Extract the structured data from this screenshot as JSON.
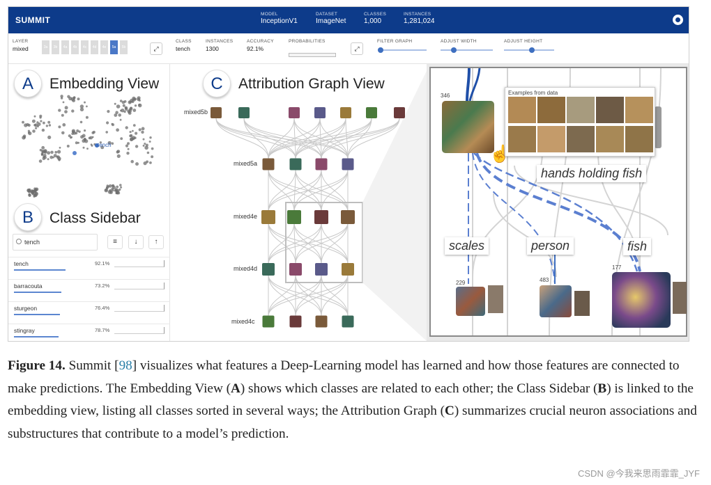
{
  "header": {
    "app_title": "SUMMIT",
    "fields": [
      {
        "key": "MODEL",
        "value": "InceptionV1"
      },
      {
        "key": "DATASET",
        "value": "ImageNet"
      },
      {
        "key": "CLASSES",
        "value": "1,000"
      },
      {
        "key": "INSTANCES",
        "value": "1,281,024"
      }
    ],
    "github_icon": "github-icon"
  },
  "controls": {
    "layer_key": "LAYER",
    "layer_value": "mixed",
    "layer_buttons": [
      "3a",
      "3b",
      "4a",
      "4b",
      "4c",
      "4d",
      "4e",
      "5a",
      "5b"
    ],
    "layer_selected": "5a",
    "class_key": "CLASS",
    "class_value": "tench",
    "instances_key": "INSTANCES",
    "instances_value": "1300",
    "accuracy_key": "ACCURACY",
    "accuracy_value": "92.1%",
    "probabilities_key": "PROBABILITIES",
    "filter_graph_key": "FILTER GRAPH",
    "adjust_width_key": "ADJUST WIDTH",
    "adjust_height_key": "ADJUST HEIGHT",
    "filter_graph_level": 0.05,
    "adjust_width_level": 0.25,
    "adjust_height_level": 0.55,
    "expand_icon": "expand-icon"
  },
  "embedding": {
    "badge": "A",
    "title": "Embedding View",
    "highlight_label": "tench"
  },
  "sidebar": {
    "badge": "B",
    "title": "Class Sidebar",
    "search_value": "tench",
    "sort_icons": [
      "sort-lines-icon",
      "arrow-down-icon",
      "arrow-up-icon"
    ],
    "classes": [
      {
        "name": "tench",
        "accuracy": "92.1%",
        "level": 0.92
      },
      {
        "name": "barracouta",
        "accuracy": "73.2%",
        "level": 0.73
      },
      {
        "name": "sturgeon",
        "accuracy": "76.4%",
        "level": 0.76
      },
      {
        "name": "stingray",
        "accuracy": "78.7%",
        "level": 0.79
      }
    ]
  },
  "graph": {
    "badge": "C",
    "title": "Attribution Graph View",
    "layers": [
      "mixed5b",
      "mixed5a",
      "mixed4e",
      "mixed4d",
      "mixed4c"
    ]
  },
  "zoom": {
    "examples_title": "Examples from data",
    "tags": {
      "hands": "hands holding fish",
      "scales": "scales",
      "person": "person",
      "fish": "fish"
    },
    "counts": {
      "top": "346",
      "scales": "229",
      "person": "483",
      "fish": "177"
    },
    "cursor_icon": "hand-cursor-icon"
  },
  "caption": {
    "lead": "Figure 14.",
    "part1": " Summit [",
    "cite": "98",
    "part2": "] visualizes what features a Deep-Learning model has learned and how those features are connected to make predictions. The Embedding View (",
    "a": "A",
    "part3": ") shows which classes are related to each other; the Class Sidebar (",
    "b": "B",
    "part4": ") is linked to the embedding view, listing all classes sorted in several ways; the Attribution Graph (",
    "c": "C",
    "part5": ") summarizes crucial neuron associations and substructures that contribute to a model’s prediction."
  },
  "watermark": "CSDN @今我来思雨霏霏_JYF",
  "colors": {
    "brand": "#0d3b8a",
    "accent": "#3e6fc0",
    "edge": "#5b7fd0"
  }
}
